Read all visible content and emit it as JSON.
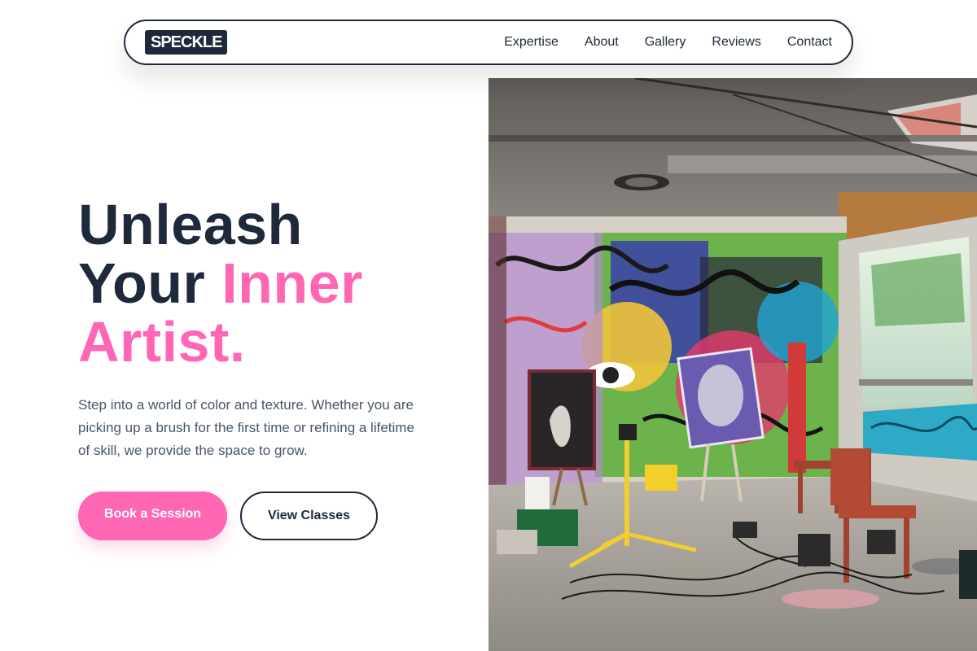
{
  "nav": {
    "logo": "SPECKLE",
    "links": [
      {
        "label": "Expertise"
      },
      {
        "label": "About"
      },
      {
        "label": "Gallery"
      },
      {
        "label": "Reviews"
      },
      {
        "label": "Contact"
      }
    ]
  },
  "hero": {
    "headline": {
      "line1": "Unleash",
      "line2_plain": "Your ",
      "line2_accent": "Inner",
      "line3_accent": "Artist."
    },
    "lead": "Step into a world of color and texture. Whether you are picking up a brush for the first time or refining a lifetime of skill, we provide the space to grow.",
    "primary_cta": "Book a Session",
    "secondary_cta": "View Classes",
    "image_icon": "graffiti-art-studio-photo"
  },
  "colors": {
    "primary": "#1e293b",
    "accent": "#ff66b3",
    "text_muted": "#475569",
    "background": "#ffffff"
  }
}
